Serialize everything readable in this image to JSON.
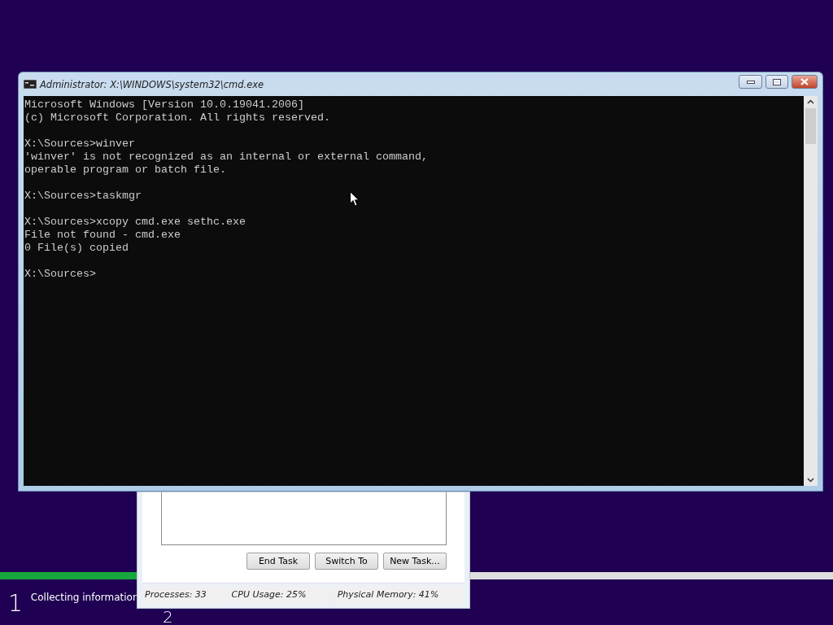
{
  "setup": {
    "progress": {
      "level": 0.165
    },
    "steps": [
      {
        "number": "1",
        "label": "Collecting information"
      },
      {
        "number": "2"
      }
    ]
  },
  "task_manager": {
    "buttons": [
      "End Task",
      "Switch To",
      "New Task..."
    ],
    "status_bar": [
      "Processes: 33",
      "CPU Usage: 25%",
      "Physical Memory: 41%"
    ]
  },
  "console_window": {
    "title": "Administrator: X:\\WINDOWS\\system32\\cmd.exe",
    "blocks": [
      [
        "Microsoft Windows [Version 10.0.19041.2006]",
        "(c) Microsoft Corporation. All rights reserved."
      ],
      [
        "X:\\Sources>winver",
        "'winver' is not recognized as an internal or external command,",
        "operable program or batch file."
      ],
      [
        "X:\\Sources>taskmgr"
      ],
      [
        "X:\\Sources>xcopy cmd.exe sethc.exe",
        "File not found - cmd.exe",
        "0 File(s) copied"
      ],
      [
        "X:\\Sources>"
      ]
    ]
  }
}
